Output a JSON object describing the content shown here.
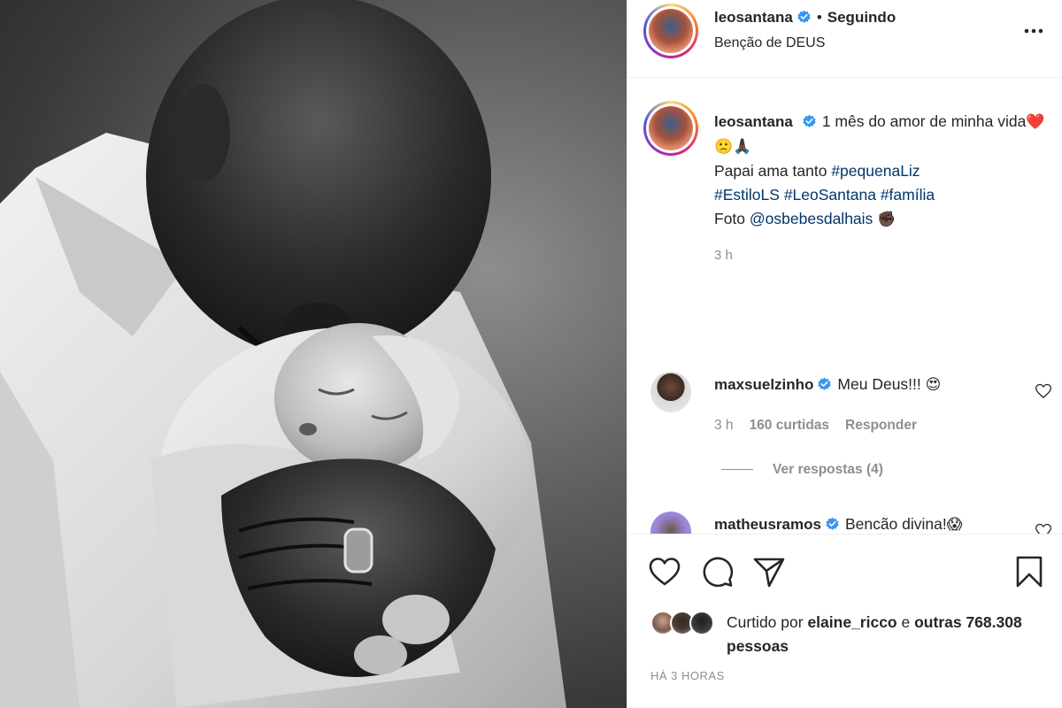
{
  "post": {
    "username": "leosantana",
    "follow_status": "Seguindo",
    "location": "Benção de DEUS"
  },
  "caption": {
    "username": "leosantana",
    "text_1": "1 mês do amor de minha vida",
    "emojis_1": "❤️🙁🙏🏿",
    "text_2": "Papai ama tanto",
    "tag_1": "#pequenaLiz",
    "tag_2": "#EstiloLS",
    "tag_3": "#LeoSantana",
    "tag_4": "#família",
    "text_3": "Foto",
    "mention": "@osbebesdalhais",
    "emoji_2": "✊🏿",
    "time": "3 h"
  },
  "comments": [
    {
      "username": "maxsuelzinho",
      "text": "Meu Deus!!!",
      "emoji": "😍",
      "time": "3 h",
      "likes": "160 curtidas",
      "reply": "Responder",
      "view_replies": "Ver respostas (4)"
    },
    {
      "username": "matheusramos",
      "text": "Bencão divina!",
      "emoji": "😱"
    }
  ],
  "likes": {
    "prefix": "Curtido por",
    "user": "elaine_ricco",
    "connector": "e",
    "others": "outras 768.308 pessoas"
  },
  "posted_ago": "HÁ 3 HORAS",
  "icons": {
    "more": "more-horizontal-icon",
    "verified": "verified-badge-icon",
    "like": "heart-icon",
    "comment": "comment-bubble-icon",
    "share": "paper-plane-icon",
    "save": "bookmark-icon"
  },
  "colors": {
    "text": "#262626",
    "muted": "#8e8e8e",
    "hashtag": "#00376b",
    "verified": "#3897f0"
  }
}
